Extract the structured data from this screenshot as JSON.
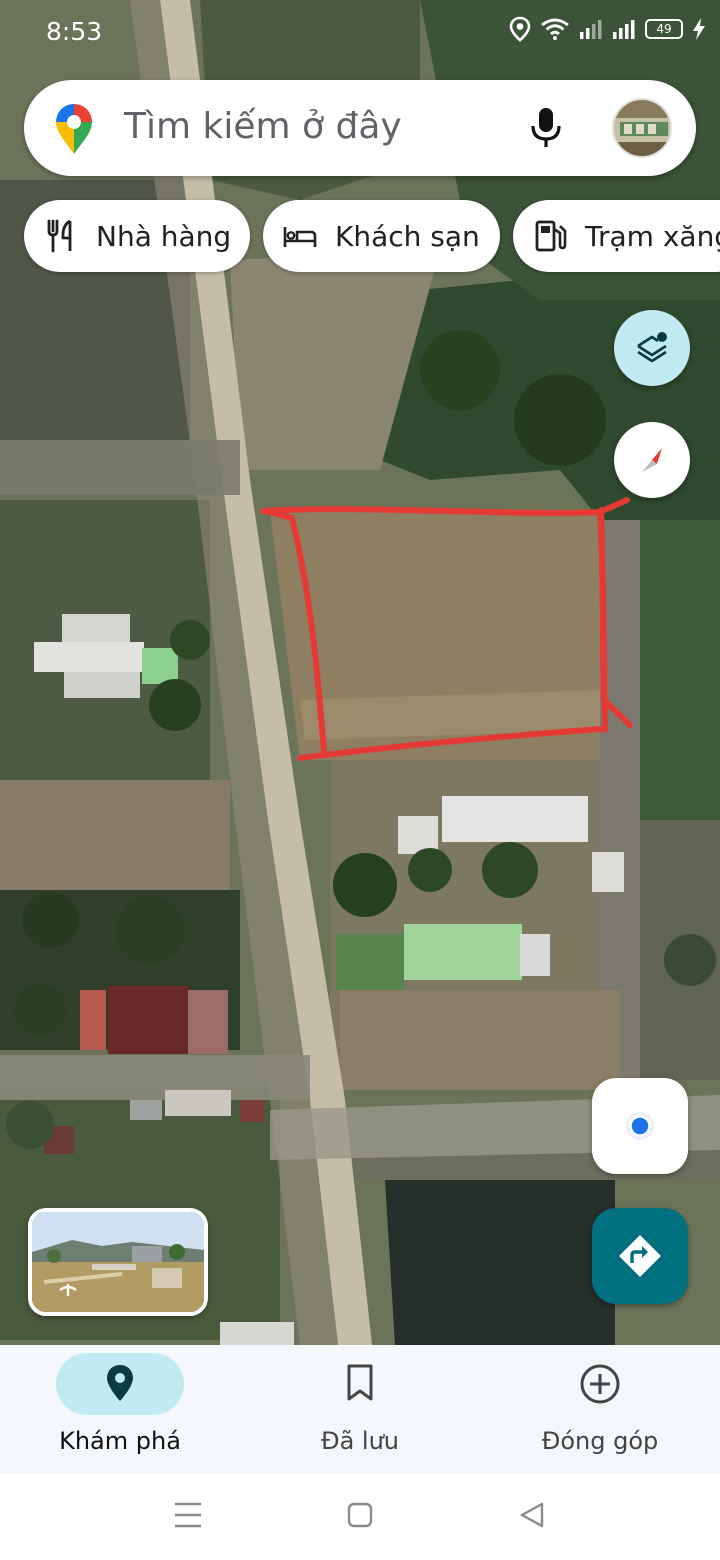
{
  "status_bar": {
    "time": "8:53",
    "battery": "49",
    "icons": [
      "location-icon",
      "wifi-icon",
      "signal-icon",
      "signal-icon",
      "battery-icon",
      "charging-icon"
    ]
  },
  "search": {
    "placeholder": "Tìm kiếm ở đây",
    "icons": [
      "maps-pin-icon",
      "microphone-icon",
      "avatar"
    ]
  },
  "chips": [
    {
      "label": "Nhà hàng",
      "icon": "fork-knife-icon"
    },
    {
      "label": "Khách sạn",
      "icon": "bed-icon"
    },
    {
      "label": "Trạm xăng",
      "icon": "gas-pump-icon"
    }
  ],
  "map_controls": {
    "layers": "layers-icon",
    "compass": "compass-icon",
    "my_location": "my-location-icon",
    "directions": "directions-icon",
    "street_view": "street-view-thumbnail"
  },
  "bottom_nav": [
    {
      "label": "Khám phá",
      "icon": "explore-pin-icon",
      "active": true
    },
    {
      "label": "Đã lưu",
      "icon": "bookmark-icon",
      "active": false
    },
    {
      "label": "Đóng góp",
      "icon": "add-circle-icon",
      "active": false
    }
  ],
  "colors": {
    "accent": "#00707e",
    "nav_active_pill": "#c2eaf3",
    "layers_button": "#c2eaf3",
    "annotation_red": "#e53935"
  }
}
